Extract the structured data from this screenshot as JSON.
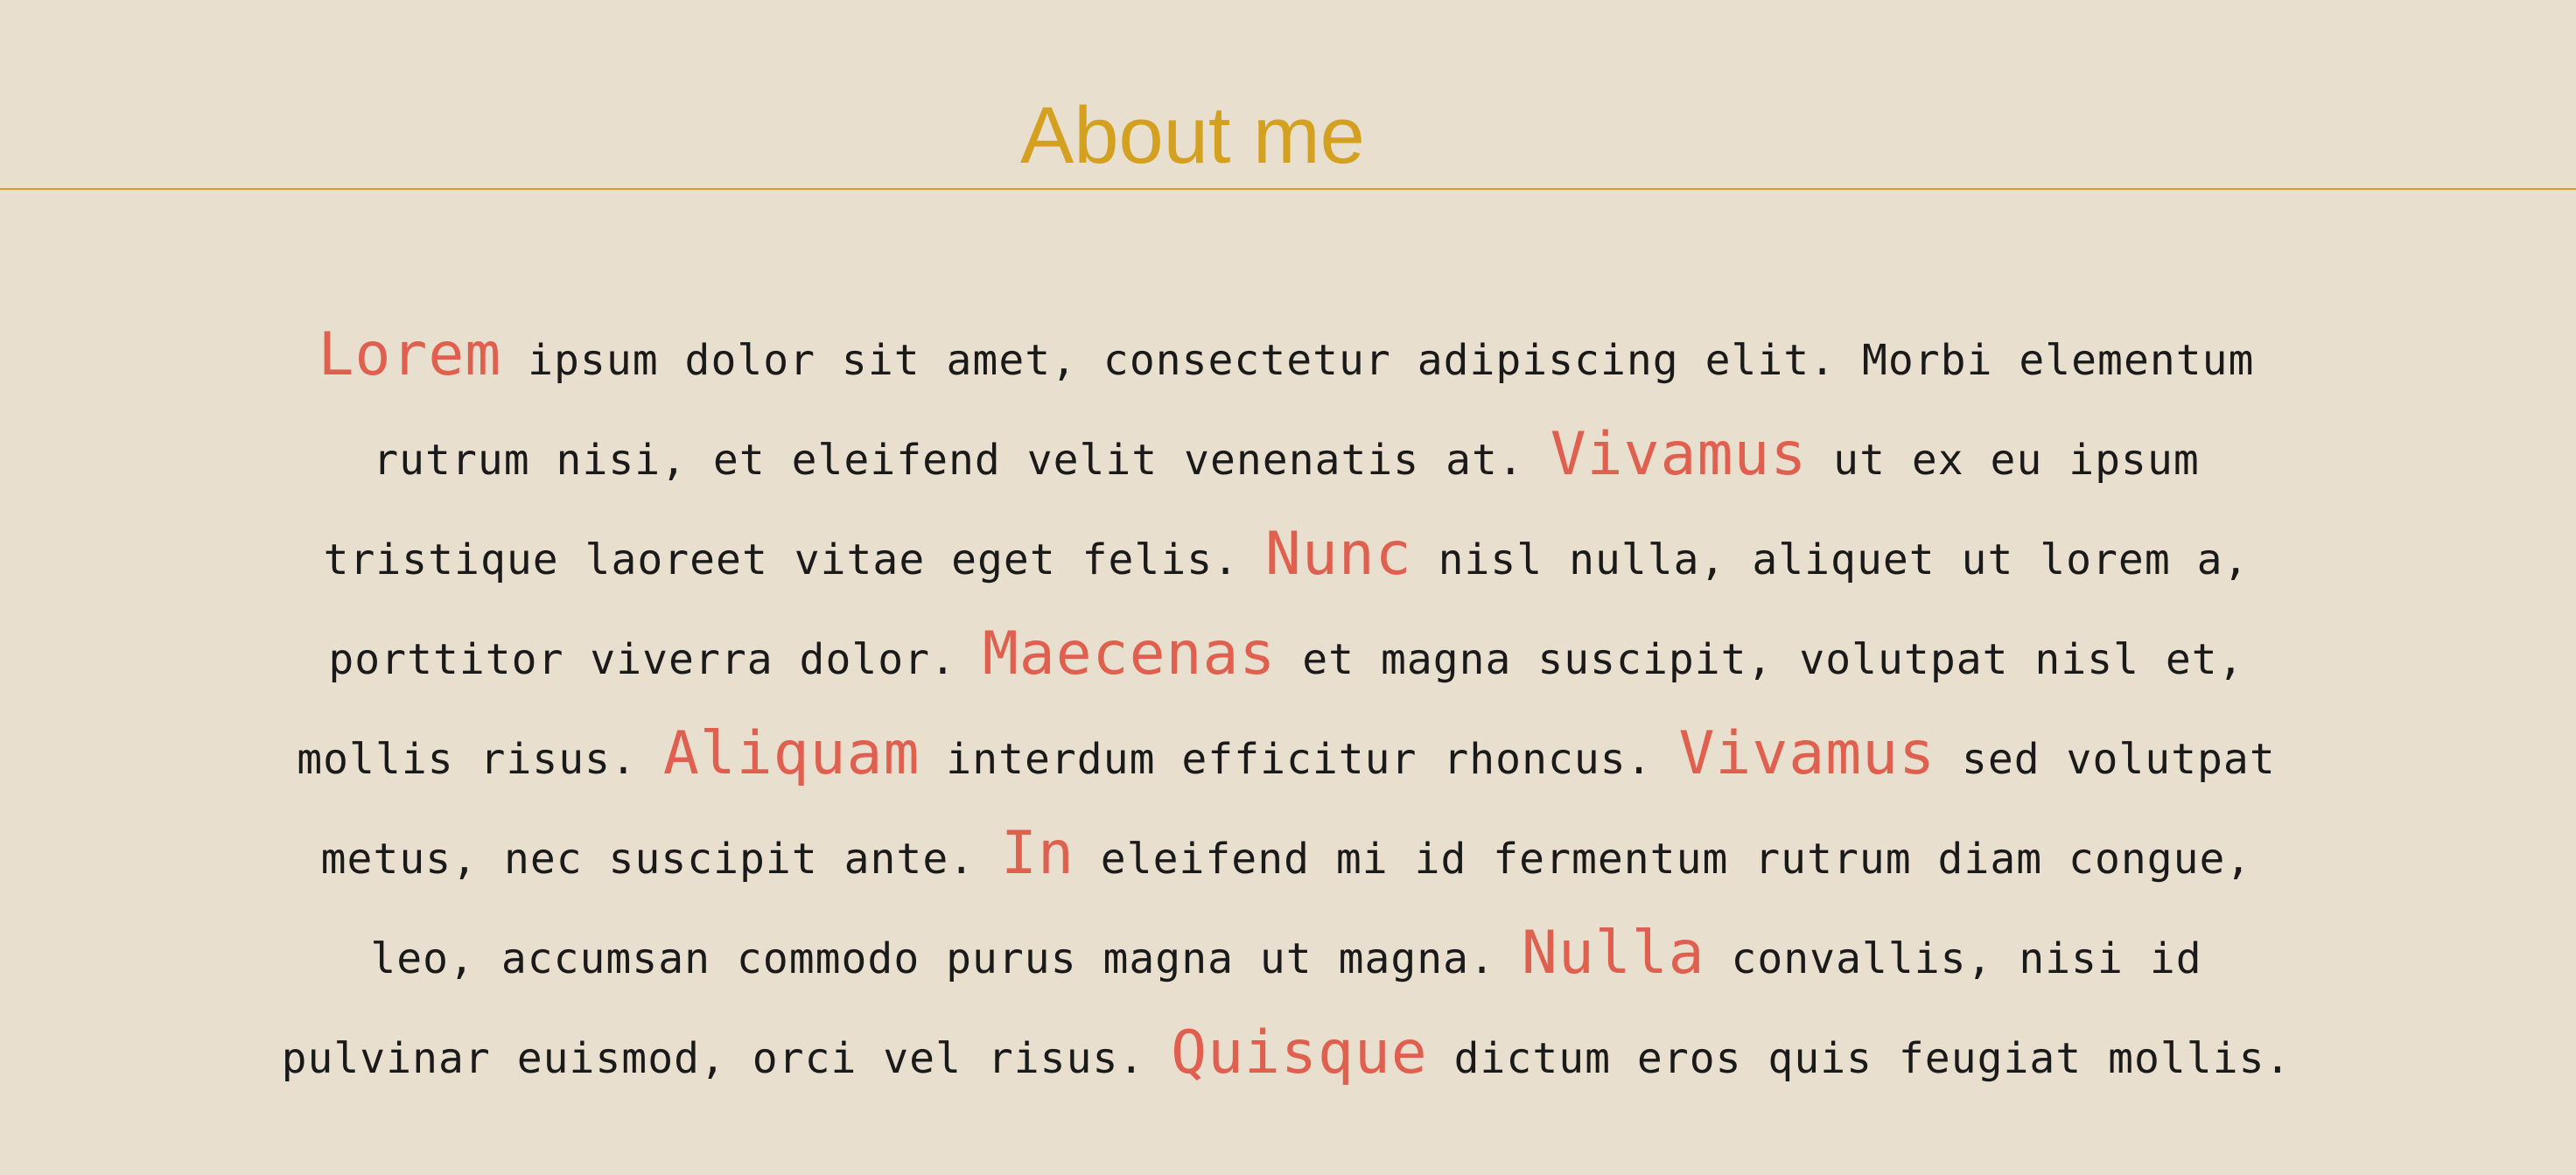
{
  "page": {
    "title": "About me",
    "accent_color": "#d4a020",
    "highlight_color": "#e06050",
    "background_color": "#e8dfcf"
  },
  "about": {
    "lines": [
      {
        "h1": "Lorem",
        "t1": " ipsum dolor sit amet, consectetur adipiscing elit. Morbi elementum"
      },
      {
        "t0": "rutrum nisi, et eleifend velit venenatis at. ",
        "h1": "Vivamus",
        "t1": " ut ex eu ipsum"
      },
      {
        "t0": "tristique laoreet vitae eget felis. ",
        "h1": "Nunc",
        "t1": " nisl nulla, aliquet ut lorem a,"
      },
      {
        "t0": "porttitor viverra dolor. ",
        "h1": "Maecenas",
        "t1": " et magna suscipit, volutpat nisl et,"
      },
      {
        "t0": "mollis risus. ",
        "h1": "Aliquam",
        "t1": " interdum efficitur rhoncus. ",
        "h2": "Vivamus",
        "t2": " sed volutpat"
      },
      {
        "t0": "metus, nec suscipit ante. ",
        "h1": "In",
        "t1": " eleifend mi id fermentum rutrum diam congue,"
      },
      {
        "t0": "leo, accumsan commodo purus magna ut magna. ",
        "h1": "Nulla",
        "t1": " convallis, nisi id"
      },
      {
        "t0": "pulvinar euismod, orci vel risus. ",
        "h1": "Quisque",
        "t1": " dictum eros quis feugiat mollis."
      }
    ]
  }
}
